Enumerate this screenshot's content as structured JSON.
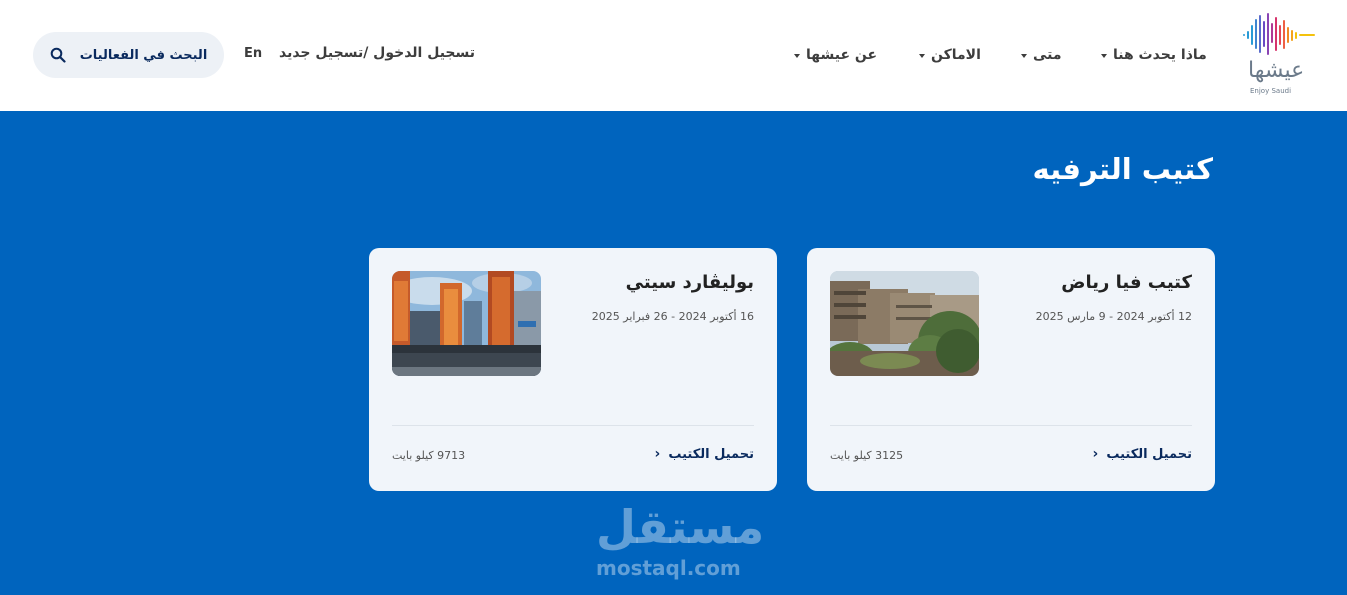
{
  "header": {
    "logo": {
      "text_ar": "عيشها",
      "text_en": "Enjoy Saudi",
      "colors": [
        "#2a9bd6",
        "#6a4bc4",
        "#d6336c",
        "#f08a24",
        "#f4c20d"
      ]
    },
    "nav": [
      {
        "label": "ماذا يحدث هنا"
      },
      {
        "label": "متى"
      },
      {
        "label": "الاماكن"
      },
      {
        "label": "عن عيشها"
      }
    ],
    "login_label": "تسجيل الدخول /تسجيل جديد",
    "lang_label": "En",
    "search": {
      "label": "البحث في الفعاليات",
      "icon": "search-icon"
    }
  },
  "main": {
    "title": "كتيب الترفيه",
    "cards": [
      {
        "title": "كتيب فيا رياض",
        "dates": "12 أكتوبر 2024 - 9 مارس 2025",
        "download_label": "تحميل الكتيب",
        "size": "3125 كيلو بايت"
      },
      {
        "title": "بوليڤارد سيتي",
        "dates": "16 أكتوبر 2024 - 26 فبراير 2025",
        "download_label": "تحميل الكتيب",
        "size": "9713 كيلو بايت"
      }
    ]
  },
  "watermark": {
    "text_ar": "مستقل",
    "text_en": "mostaql.com"
  },
  "colors": {
    "primary_blue": "#0064be",
    "header_bg": "#ffffff",
    "card_bg": "#f1f5fa",
    "navy_text": "#0a2a5e"
  }
}
